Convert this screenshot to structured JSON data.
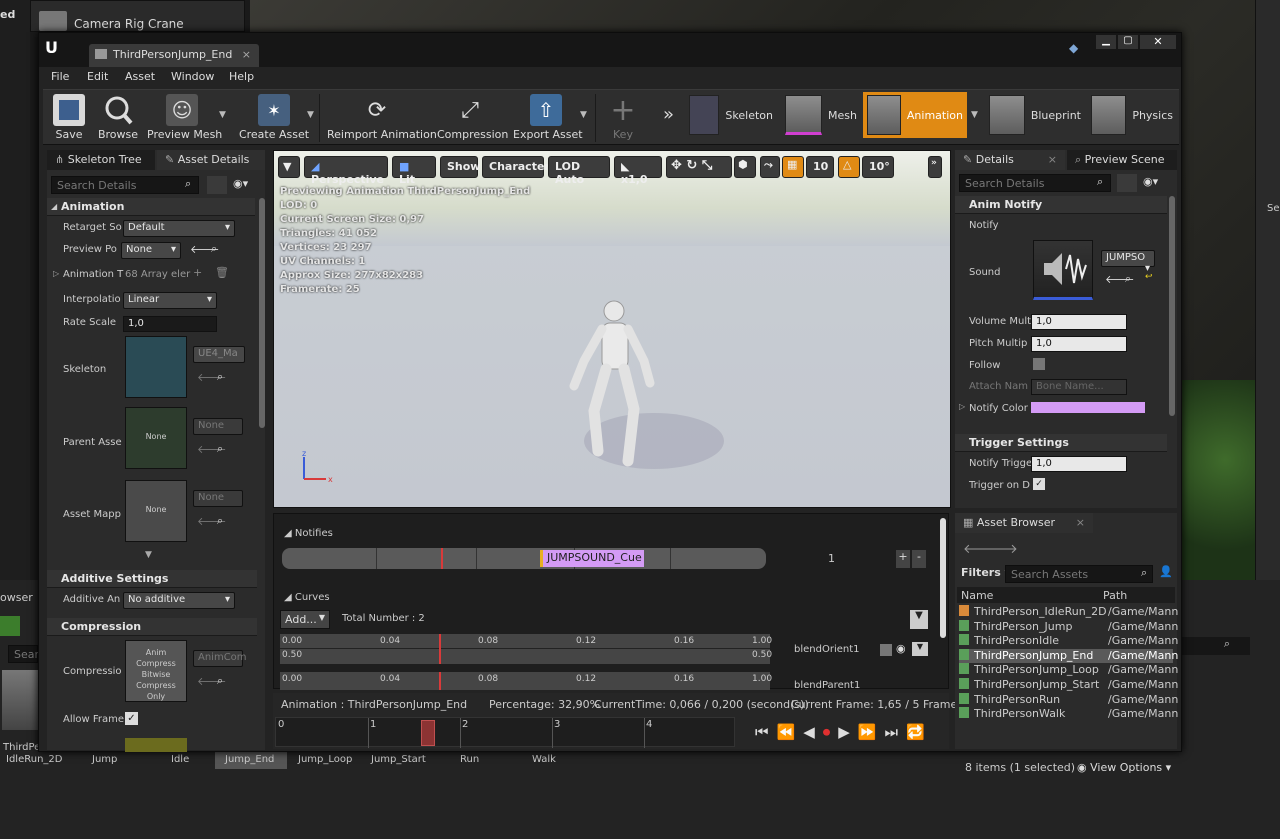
{
  "background": {
    "top_partial_text": "ed",
    "level_item": "Camera Rig Crane",
    "content_browser_tab": "owser",
    "content_browser_search": "Searc",
    "content_browser_thumb_label": "ThirdPe",
    "bottom_labels": [
      "IdleRun_2D",
      "Jump",
      "Idle",
      "Jump_End",
      "Jump_Loop",
      "Jump_Start",
      "Run",
      "Walk"
    ],
    "right_partial_text": "Sel"
  },
  "window": {
    "tab_title": "ThirdPersonJump_End",
    "menu": [
      "File",
      "Edit",
      "Asset",
      "Window",
      "Help"
    ],
    "toolbar": {
      "save": "Save",
      "browse": "Browse",
      "preview_mesh": "Preview Mesh",
      "create_asset": "Create Asset",
      "reimport": "Reimport Animation",
      "compression": "Compression",
      "export_asset": "Export Asset",
      "key": "Key"
    },
    "modes": [
      "Skeleton",
      "Mesh",
      "Animation",
      "Blueprint",
      "Physics"
    ],
    "active_mode": "Animation",
    "accent_color": "#e08a14"
  },
  "left_panel": {
    "tabs": [
      "Skeleton Tree",
      "Asset Details"
    ],
    "search_placeholder": "Search Details",
    "animation_section": "Animation",
    "props": {
      "retarget_label": "Retarget So",
      "retarget_value": "Default",
      "preview_pose_label": "Preview Po",
      "preview_pose_value": "None",
      "anim_track_label": "Animation T",
      "anim_track_value": "68 Array eler",
      "interpolation_label": "Interpolatio",
      "interpolation_value": "Linear",
      "rate_scale_label": "Rate Scale",
      "rate_scale_value": "1,0",
      "skeleton_label": "Skeleton",
      "skeleton_value": "UE4_Ma",
      "parent_asset_label": "Parent Asse",
      "parent_thumb": "None",
      "parent_value": "None",
      "asset_mapping_label": "Asset Mapp",
      "mapping_thumb": "None",
      "mapping_value": "None"
    },
    "additive_section": "Additive Settings",
    "additive_label": "Additive An",
    "additive_value": "No additive",
    "compression_section": "Compression",
    "compression_label": "Compressio",
    "compression_thumb": "Anim Compress Bitwise Compress Only",
    "compression_value": "AnimCom",
    "allow_frame_label": "Allow Frame"
  },
  "viewport": {
    "buttons": [
      "Perspective",
      "Lit",
      "Show",
      "Character",
      "LOD Auto",
      "x1,0"
    ],
    "grid_value": "10",
    "angle_value": "10°",
    "stats": [
      "Previewing Animation ThirdPersonJump_End",
      "LOD: 0",
      "Current Screen Size: 0,97",
      "Triangles: 41 052",
      "Vertices: 23 297",
      "UV Channels: 1",
      "Approx Size: 277x82x283",
      "Framerate: 25"
    ]
  },
  "timeline": {
    "notifies_label": "Notifies",
    "notify_name": "JUMPSOUND_Cue",
    "track_number": "1",
    "curves_label": "Curves",
    "add_button": "Add...",
    "total_number": "Total Number : 2",
    "curve_ticks": [
      "0.00",
      "0.04",
      "0.08",
      "0.12",
      "0.16",
      "1.00"
    ],
    "curve_mid_left": "0.50",
    "curve_mid_right": "0.50",
    "curve1_name": "blendOrient1",
    "curve2_name": "blendParent1",
    "status": {
      "animation": "Animation :  ThirdPersonJump_End",
      "percentage": "Percentage:  32,90%",
      "current_time": "CurrentTime:  0,066 / 0,200 (second(s))",
      "current_frame": "Current Frame:  1,65 / 5 Frame"
    },
    "frame_ticks": [
      "0",
      "1",
      "2",
      "3",
      "4"
    ],
    "scrubber_fraction": 0.33
  },
  "details_panel": {
    "tabs": [
      "Details",
      "Preview Scene"
    ],
    "search_placeholder": "Search Details",
    "anim_notify_section": "Anim Notify",
    "notify_label": "Notify",
    "sound_label": "Sound",
    "sound_value": "JUMPSO",
    "volume_label": "Volume Mult",
    "volume_value": "1,0",
    "pitch_label": "Pitch Multip",
    "pitch_value": "1,0",
    "follow_label": "Follow",
    "attach_label": "Attach Nam",
    "attach_placeholder": "Bone Name...",
    "notify_color_label": "Notify Color",
    "notify_color": "#d49bf5",
    "trigger_section": "Trigger Settings",
    "notify_trigger_label": "Notify Trigge",
    "notify_trigger_value": "1,0",
    "trigger_on_label": "Trigger on D"
  },
  "asset_browser": {
    "tab": "Asset Browser",
    "filters": "Filters",
    "search_placeholder": "Search Assets",
    "col_name": "Name",
    "col_path": "Path",
    "rows": [
      {
        "name": "ThirdPerson_IdleRun_2D",
        "path": "/Game/Mann"
      },
      {
        "name": "ThirdPerson_Jump",
        "path": "/Game/Mann"
      },
      {
        "name": "ThirdPersonIdle",
        "path": "/Game/Mann"
      },
      {
        "name": "ThirdPersonJump_End",
        "path": "/Game/Mann"
      },
      {
        "name": "ThirdPersonJump_Loop",
        "path": "/Game/Mann"
      },
      {
        "name": "ThirdPersonJump_Start",
        "path": "/Game/Mann"
      },
      {
        "name": "ThirdPersonRun",
        "path": "/Game/Mann"
      },
      {
        "name": "ThirdPersonWalk",
        "path": "/Game/Mann"
      }
    ],
    "selected_index": 3,
    "count": "8 items (1 selected)",
    "view_options": "View Options"
  }
}
